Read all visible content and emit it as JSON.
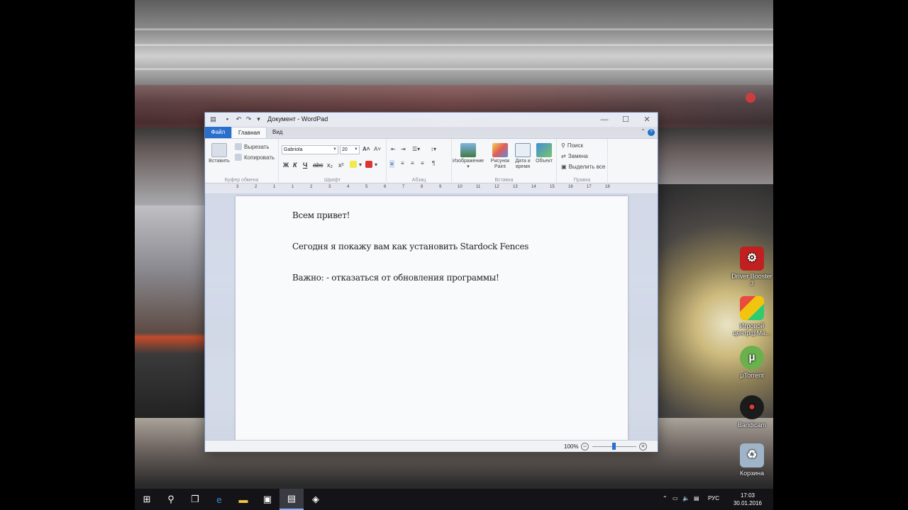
{
  "window": {
    "title": "Документ - WordPad",
    "tabs": [
      {
        "label": "Файл"
      },
      {
        "label": "Главная"
      },
      {
        "label": "Вид"
      }
    ],
    "controls": {
      "minimize": "—",
      "maximize": "☐",
      "close": "✕"
    }
  },
  "ribbon": {
    "clipboard": {
      "paste": "Вставить",
      "cut": "Вырезать",
      "copy": "Копировать",
      "label": "Буфер обмена"
    },
    "font": {
      "family": "Gabriola",
      "size": "20",
      "label": "Шрифт",
      "bold": "Ж",
      "italic": "К",
      "underline": "Ч",
      "strike": "abc",
      "subscript": "x₂",
      "superscript": "x²"
    },
    "paragraph": {
      "label": "Абзац"
    },
    "insert": {
      "image": "Изображение",
      "paint": "Рисунок Paint",
      "datetime": "Дата и время",
      "object": "Объект",
      "label": "Вставка"
    },
    "editing": {
      "find": "Поиск",
      "replace": "Замена",
      "select_all": "Выделить все",
      "label": "Правка"
    }
  },
  "ruler": {
    "ticks": [
      "3",
      "2",
      "1",
      "1",
      "2",
      "3",
      "4",
      "5",
      "6",
      "7",
      "8",
      "9",
      "10",
      "11",
      "12",
      "13",
      "14",
      "15",
      "16",
      "17",
      "18"
    ]
  },
  "document": {
    "lines": [
      "Всем привет!",
      "Сегодня я покажу вам как установить Stardock Fences",
      "Важно: - отказаться от обновления программы!"
    ]
  },
  "status": {
    "zoom": "100%"
  },
  "desktop": {
    "icons": [
      {
        "label": "Driver Booster 3",
        "color": "#c0201f"
      },
      {
        "label": "Игровой центр@Ma...",
        "color": "#3a7bd5"
      },
      {
        "label": "µTorrent",
        "color": "#6ab04c"
      },
      {
        "label": "Bandicam",
        "color": "#1b1b1b"
      },
      {
        "label": "Корзина",
        "color": "#9fb4c8"
      }
    ]
  },
  "taskbar": {
    "tray": {
      "lang": "РУС",
      "time": "17:03",
      "date": "30.01.2016"
    }
  }
}
